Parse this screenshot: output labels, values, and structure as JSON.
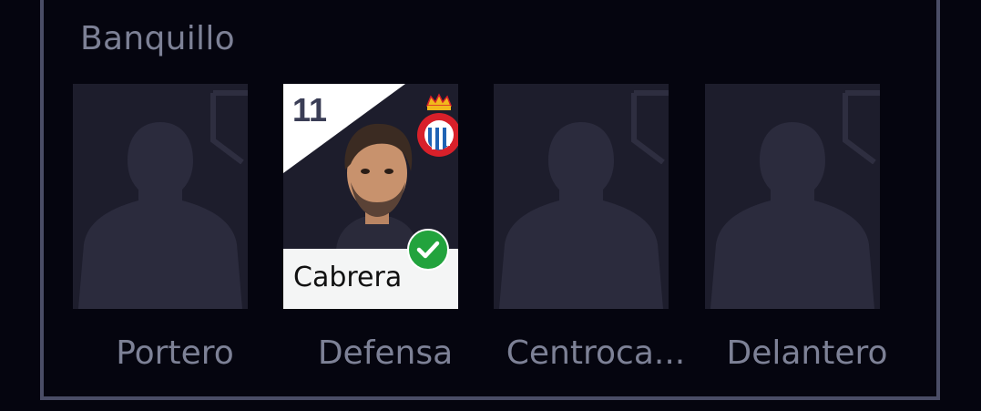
{
  "section": {
    "title": "Banquillo"
  },
  "slots": [
    {
      "position": "Portero",
      "filled": false
    },
    {
      "position": "Defensa",
      "filled": true,
      "player": {
        "number": "11",
        "name": "Cabrera",
        "club_logo": "espanyol-crest-icon",
        "selected_icon": "check-icon"
      }
    },
    {
      "position": "Centroca...",
      "filled": false
    },
    {
      "position": "Delantero",
      "filled": false
    }
  ],
  "colors": {
    "background": "#05050f",
    "panel_border": "#4a4d66",
    "card_bg": "#1d1d2c",
    "silhouette": "#2b2b3d",
    "label": "#7d8196",
    "check": "#22a33d",
    "club_blue": "#1f63b4",
    "club_red": "#d8202a"
  }
}
